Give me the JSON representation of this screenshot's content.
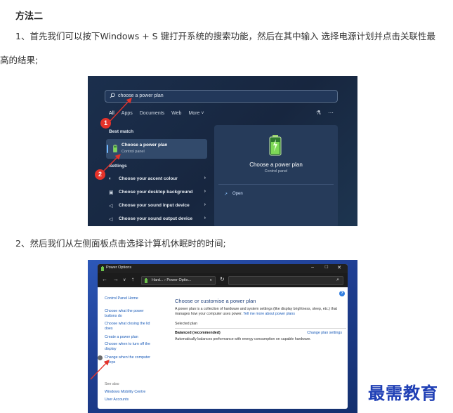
{
  "article": {
    "heading": "方法二",
    "step1_line1": "1、首先我们可以按下Windows + S 键打开系统的搜索功能，然后在其中输入 选择电源计划并点击关联性最",
    "step1_line2": "高的结果;",
    "step2": "2、然后我们从左侧面板点击选择计算机休眠时的时间;"
  },
  "search_screenshot": {
    "query": "choose a power plan",
    "tabs": [
      "All",
      "Apps",
      "Documents",
      "Web",
      "More"
    ],
    "best_match_label": "Best match",
    "best_match": {
      "title": "Choose a power plan",
      "subtitle": "Control panel"
    },
    "settings_label": "Settings",
    "settings_items": [
      {
        "icon": "palette-icon",
        "label": "Choose your accent colour"
      },
      {
        "icon": "image-icon",
        "label": "Choose your desktop background"
      },
      {
        "icon": "speaker-icon",
        "label": "Choose your sound input device"
      },
      {
        "icon": "speaker-icon",
        "label": "Choose your sound output device"
      }
    ],
    "preview": {
      "title": "Choose a power plan",
      "subtitle": "Control panel",
      "open_label": "Open"
    },
    "markers": [
      "1",
      "2"
    ],
    "colors": {
      "marker": "#e5332a",
      "accent": "#6fb7ff"
    }
  },
  "power_options_screenshot": {
    "window_title": "Power Options",
    "address": "Hard... › Power Optio...",
    "sidebar": {
      "home": "Control Panel Home",
      "links": [
        "Choose what the power buttons do",
        "Choose what closing the lid does",
        "Create a power plan",
        "Choose when to turn off the display",
        "Change when the computer sleeps"
      ],
      "see_also": "See also",
      "see_also_links": [
        "Windows Mobility Centre",
        "User Accounts"
      ]
    },
    "main": {
      "title": "Choose or customise a power plan",
      "description": "A power plan is a collection of hardware and system settings (like display brightness, sleep, etc.) that manages how your computer uses power.",
      "description_link": "Tell me more about power plans",
      "selected_plan_label": "Selected plan",
      "plan_name": "Balanced (recommended)",
      "change_link": "Change plan settings",
      "plan_desc": "Automatically balances performance with energy consumption on capable hardware."
    }
  },
  "watermark": "最需教育"
}
